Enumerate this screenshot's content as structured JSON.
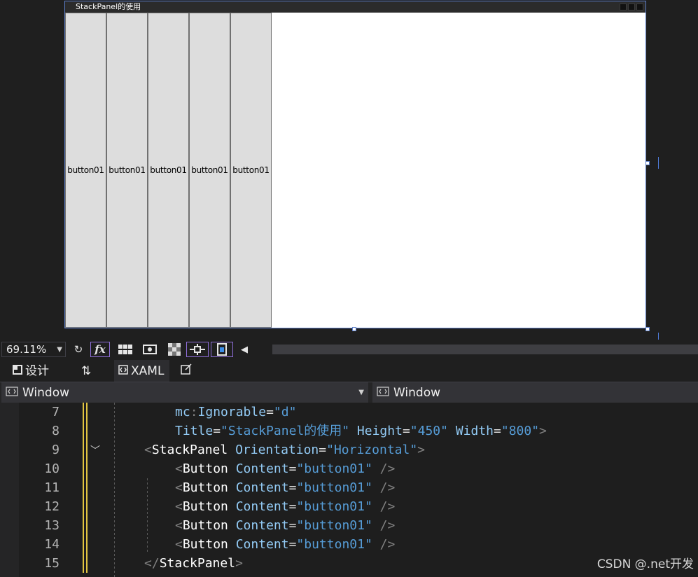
{
  "designer": {
    "window_title": "StackPanel的使用",
    "buttons": [
      "button01",
      "button01",
      "button01",
      "button01",
      "button01"
    ]
  },
  "toolbar": {
    "zoom": "69.11%",
    "icons": [
      "refresh-icon",
      "fx-icon",
      "grid-icon",
      "snap-icon",
      "checker-icon",
      "crosshair-icon",
      "device-icon",
      "scroll-left-icon"
    ]
  },
  "split_tabs": {
    "design_label": "设计",
    "swap_icon": "swap-icon",
    "xaml_label": "XAML",
    "popout_icon": "popout-icon"
  },
  "navbar": {
    "left_value": "Window",
    "right_value": "Window"
  },
  "editor": {
    "lines": [
      {
        "n": "7",
        "indent": "        ",
        "parts": [
          [
            "pfx",
            "mc"
          ],
          [
            "punc",
            ":"
          ],
          [
            "attr",
            "Ignorable"
          ],
          [
            "eq",
            "="
          ],
          [
            "val",
            "\"d\""
          ]
        ]
      },
      {
        "n": "8",
        "indent": "        ",
        "parts": [
          [
            "attr",
            "Title"
          ],
          [
            "eq",
            "="
          ],
          [
            "val",
            "\"StackPanel的使用\""
          ],
          [
            "eq",
            " "
          ],
          [
            "attr",
            "Height"
          ],
          [
            "eq",
            "="
          ],
          [
            "val",
            "\"450\""
          ],
          [
            "eq",
            " "
          ],
          [
            "attr",
            "Width"
          ],
          [
            "eq",
            "="
          ],
          [
            "val",
            "\"800\""
          ],
          [
            "punc",
            ">"
          ]
        ]
      },
      {
        "n": "9",
        "indent": "    ",
        "parts": [
          [
            "punc",
            "<"
          ],
          [
            "tag",
            "StackPanel"
          ],
          [
            "eq",
            " "
          ],
          [
            "attr",
            "Orientation"
          ],
          [
            "eq",
            "="
          ],
          [
            "val",
            "\"Horizontal\""
          ],
          [
            "punc",
            ">"
          ]
        ]
      },
      {
        "n": "10",
        "indent": "        ",
        "parts": [
          [
            "punc",
            "<"
          ],
          [
            "tag",
            "Button"
          ],
          [
            "eq",
            " "
          ],
          [
            "attr",
            "Content"
          ],
          [
            "eq",
            "="
          ],
          [
            "val",
            "\"button01\""
          ],
          [
            "eq",
            " "
          ],
          [
            "punc",
            "/>"
          ]
        ]
      },
      {
        "n": "11",
        "indent": "        ",
        "parts": [
          [
            "punc",
            "<"
          ],
          [
            "tag",
            "Button"
          ],
          [
            "eq",
            " "
          ],
          [
            "attr",
            "Content"
          ],
          [
            "eq",
            "="
          ],
          [
            "val",
            "\"button01\""
          ],
          [
            "eq",
            " "
          ],
          [
            "punc",
            "/>"
          ]
        ]
      },
      {
        "n": "12",
        "indent": "        ",
        "parts": [
          [
            "punc",
            "<"
          ],
          [
            "tag",
            "Button"
          ],
          [
            "eq",
            " "
          ],
          [
            "attr",
            "Content"
          ],
          [
            "eq",
            "="
          ],
          [
            "val",
            "\"button01\""
          ],
          [
            "eq",
            " "
          ],
          [
            "punc",
            "/>"
          ]
        ]
      },
      {
        "n": "13",
        "indent": "        ",
        "parts": [
          [
            "punc",
            "<"
          ],
          [
            "tag",
            "Button"
          ],
          [
            "eq",
            " "
          ],
          [
            "attr",
            "Content"
          ],
          [
            "eq",
            "="
          ],
          [
            "val",
            "\"button01\""
          ],
          [
            "eq",
            " "
          ],
          [
            "punc",
            "/>"
          ]
        ]
      },
      {
        "n": "14",
        "indent": "        ",
        "parts": [
          [
            "punc",
            "<"
          ],
          [
            "tag",
            "Button"
          ],
          [
            "eq",
            " "
          ],
          [
            "attr",
            "Content"
          ],
          [
            "eq",
            "="
          ],
          [
            "val",
            "\"button01\""
          ],
          [
            "eq",
            " "
          ],
          [
            "punc",
            "/>"
          ]
        ]
      },
      {
        "n": "15",
        "indent": "    ",
        "parts": [
          [
            "punc",
            "</"
          ],
          [
            "tag",
            "StackPanel"
          ],
          [
            "punc",
            ">"
          ]
        ]
      }
    ]
  },
  "watermark": "CSDN @.net开发",
  "colors": {
    "attribute": "#92caf4",
    "value": "#569cd6",
    "tag": "#ffffff",
    "punctuation": "#808080",
    "change_marker": "#e2c541",
    "selection_border": "#5b7dc8"
  }
}
